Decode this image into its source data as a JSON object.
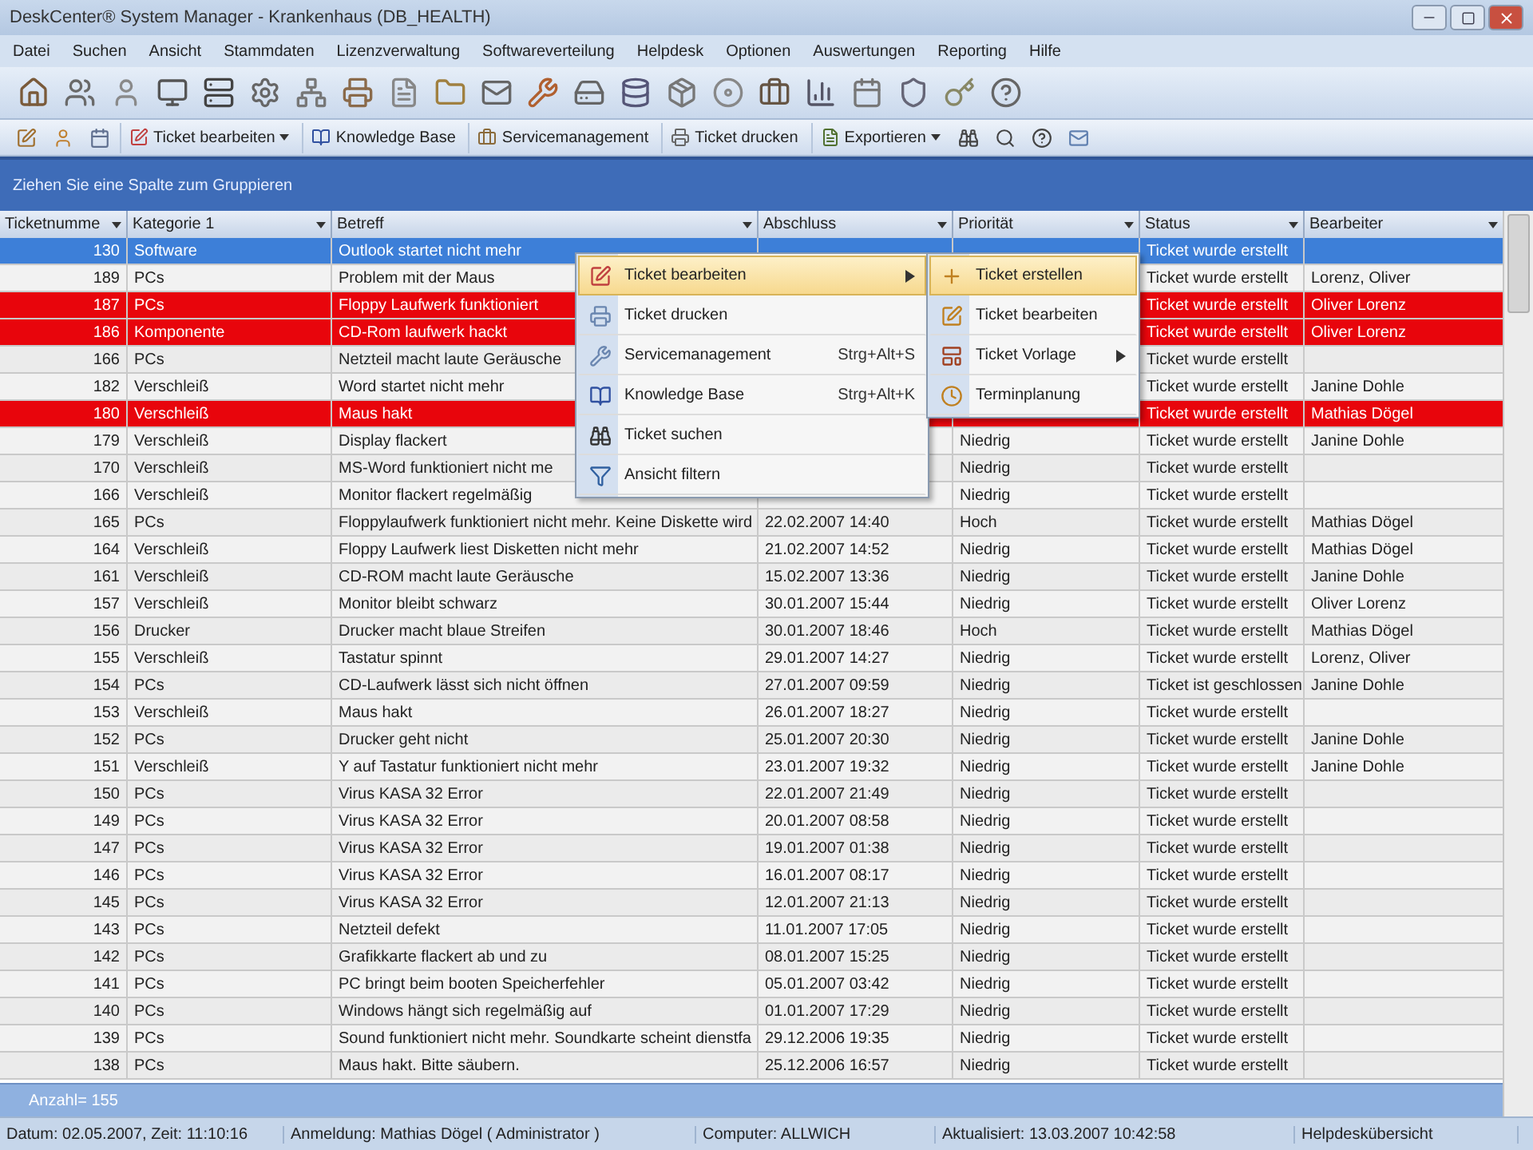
{
  "window": {
    "title": "DeskCenter® System Manager - Krankenhaus (DB_HEALTH)"
  },
  "menu": [
    "Datei",
    "Suchen",
    "Ansicht",
    "Stammdaten",
    "Lizenzverwaltung",
    "Softwareverteilung",
    "Helpdesk",
    "Optionen",
    "Auswertungen",
    "Reporting",
    "Hilfe"
  ],
  "toolbar2": [
    {
      "label": "Ticket bearbeiten",
      "dropdown": true
    },
    {
      "label": "Knowledge Base",
      "dropdown": false
    },
    {
      "label": "Servicemanagement",
      "dropdown": false
    },
    {
      "label": "Ticket drucken",
      "dropdown": false
    },
    {
      "label": "Exportieren",
      "dropdown": true
    }
  ],
  "group_banner": "Ziehen Sie eine Spalte zum Gruppieren",
  "table": {
    "columns": [
      "Ticketnumme",
      "Kategorie 1",
      "Betreff",
      "Abschluss",
      "Priorität",
      "Status",
      "Bearbeiter"
    ],
    "rows": [
      {
        "no": "130",
        "category": "Software",
        "subject": "Outlook startet nicht mehr",
        "status": "Ticket wurde erstellt",
        "flagged": false,
        "selected": true
      },
      {
        "no": "189",
        "category": "PCs",
        "subject": "Problem mit der Maus",
        "status": "Ticket wurde erstellt",
        "assignee": "Lorenz, Oliver",
        "flagged": false,
        "selected": false
      },
      {
        "no": "187",
        "category": "PCs",
        "subject": "Floppy Laufwerk funktioniert",
        "status": "Ticket wurde erstellt",
        "assignee": "Oliver Lorenz",
        "flagged": true,
        "selected": false
      },
      {
        "no": "186",
        "category": "Komponente",
        "subject": "CD-Rom laufwerk hackt",
        "status": "Ticket wurde erstellt",
        "assignee": "Oliver Lorenz",
        "flagged": true,
        "selected": false
      },
      {
        "no": "166",
        "category": "PCs",
        "subject": "Netzteil macht laute Geräusche",
        "status": "Ticket wurde erstellt",
        "flagged": false,
        "selected": false
      },
      {
        "no": "182",
        "category": "Verschleiß",
        "subject": "Word startet nicht mehr",
        "status": "Ticket wurde erstellt",
        "assignee": "Janine Dohle",
        "flagged": false,
        "selected": false
      },
      {
        "no": "180",
        "category": "Verschleiß",
        "subject": "Maus hakt",
        "status": "Ticket wurde erstellt",
        "assignee": "Mathias Dögel",
        "flagged": true,
        "selected": false
      },
      {
        "no": "179",
        "category": "Verschleiß",
        "subject": "Display flackert",
        "priority": "Niedrig",
        "status": "Ticket wurde erstellt",
        "assignee": "Janine Dohle",
        "flagged": false,
        "selected": false
      },
      {
        "no": "170",
        "category": "Verschleiß",
        "subject": "MS-Word funktioniert nicht me",
        "priority": "Niedrig",
        "status": "Ticket wurde erstellt",
        "flagged": false,
        "selected": false
      },
      {
        "no": "166",
        "category": "Verschleiß",
        "subject": "Monitor flackert regelmäßig",
        "priority": "Niedrig",
        "status": "Ticket wurde erstellt",
        "flagged": false,
        "selected": false
      },
      {
        "no": "165",
        "category": "PCs",
        "subject": "Floppylaufwerk funktioniert nicht mehr. Keine Diskette wird",
        "closed": "22.02.2007 14:40",
        "priority": "Hoch",
        "status": "Ticket wurde erstellt",
        "assignee": "Mathias Dögel",
        "flagged": false,
        "selected": false
      },
      {
        "no": "164",
        "category": "Verschleiß",
        "subject": "Floppy Laufwerk liest Disketten nicht mehr",
        "closed": "21.02.2007 14:52",
        "priority": "Niedrig",
        "status": "Ticket wurde erstellt",
        "assignee": "Mathias Dögel",
        "flagged": false,
        "selected": false
      },
      {
        "no": "161",
        "category": "Verschleiß",
        "subject": "CD-ROM macht laute Geräusche",
        "closed": "15.02.2007 13:36",
        "priority": "Niedrig",
        "status": "Ticket wurde erstellt",
        "assignee": "Janine Dohle",
        "flagged": false,
        "selected": false
      },
      {
        "no": "157",
        "category": "Verschleiß",
        "subject": "Monitor bleibt schwarz",
        "closed": "30.01.2007 15:44",
        "priority": "Niedrig",
        "status": "Ticket wurde erstellt",
        "assignee": "Oliver Lorenz",
        "flagged": false,
        "selected": false
      },
      {
        "no": "156",
        "category": "Drucker",
        "subject": "Drucker macht blaue Streifen",
        "closed": "30.01.2007 18:46",
        "priority": "Hoch",
        "status": "Ticket wurde erstellt",
        "assignee": "Mathias Dögel",
        "flagged": false,
        "selected": false
      },
      {
        "no": "155",
        "category": "Verschleiß",
        "subject": "Tastatur spinnt",
        "closed": "29.01.2007 14:27",
        "priority": "Niedrig",
        "status": "Ticket wurde erstellt",
        "assignee": "Lorenz, Oliver",
        "flagged": false,
        "selected": false
      },
      {
        "no": "154",
        "category": "PCs",
        "subject": "CD-Laufwerk lässt sich nicht öffnen",
        "closed": "27.01.2007 09:59",
        "priority": "Niedrig",
        "status": "Ticket ist geschlossen",
        "assignee": "Janine Dohle",
        "flagged": false,
        "selected": false
      },
      {
        "no": "153",
        "category": "Verschleiß",
        "subject": "Maus hakt",
        "closed": "26.01.2007 18:27",
        "priority": "Niedrig",
        "status": "Ticket wurde erstellt",
        "flagged": false,
        "selected": false
      },
      {
        "no": "152",
        "category": "PCs",
        "subject": "Drucker geht nicht",
        "closed": "25.01.2007 20:30",
        "priority": "Niedrig",
        "status": "Ticket wurde erstellt",
        "assignee": "Janine Dohle",
        "flagged": false,
        "selected": false
      },
      {
        "no": "151",
        "category": "Verschleiß",
        "subject": "Y auf Tastatur funktioniert nicht mehr",
        "closed": "23.01.2007 19:32",
        "priority": "Niedrig",
        "status": "Ticket wurde erstellt",
        "assignee": "Janine Dohle",
        "flagged": false,
        "selected": false
      },
      {
        "no": "150",
        "category": "PCs",
        "subject": "Virus KASA 32 Error",
        "closed": "22.01.2007 21:49",
        "priority": "Niedrig",
        "status": "Ticket wurde erstellt",
        "flagged": false,
        "selected": false
      },
      {
        "no": "149",
        "category": "PCs",
        "subject": "Virus KASA 32 Error",
        "closed": "20.01.2007 08:58",
        "priority": "Niedrig",
        "status": "Ticket wurde erstellt",
        "flagged": false,
        "selected": false
      },
      {
        "no": "147",
        "category": "PCs",
        "subject": "Virus KASA 32 Error",
        "closed": "19.01.2007 01:38",
        "priority": "Niedrig",
        "status": "Ticket wurde erstellt",
        "flagged": false,
        "selected": false
      },
      {
        "no": "146",
        "category": "PCs",
        "subject": "Virus KASA 32 Error",
        "closed": "16.01.2007 08:17",
        "priority": "Niedrig",
        "status": "Ticket wurde erstellt",
        "flagged": false,
        "selected": false
      },
      {
        "no": "145",
        "category": "PCs",
        "subject": "Virus KASA 32 Error",
        "closed": "12.01.2007 21:13",
        "priority": "Niedrig",
        "status": "Ticket wurde erstellt",
        "flagged": false,
        "selected": false
      },
      {
        "no": "143",
        "category": "PCs",
        "subject": "Netzteil defekt",
        "closed": "11.01.2007 17:05",
        "priority": "Niedrig",
        "status": "Ticket wurde erstellt",
        "flagged": false,
        "selected": false
      },
      {
        "no": "142",
        "category": "PCs",
        "subject": "Grafikkarte flackert ab und zu",
        "closed": "08.01.2007 15:25",
        "priority": "Niedrig",
        "status": "Ticket wurde erstellt",
        "flagged": false,
        "selected": false
      },
      {
        "no": "141",
        "category": "PCs",
        "subject": "PC bringt beim booten Speicherfehler",
        "closed": "05.01.2007 03:42",
        "priority": "Niedrig",
        "status": "Ticket wurde erstellt",
        "flagged": false,
        "selected": false
      },
      {
        "no": "140",
        "category": "PCs",
        "subject": "Windows hängt sich regelmäßig auf",
        "closed": "01.01.2007 17:29",
        "priority": "Niedrig",
        "status": "Ticket wurde erstellt",
        "flagged": false,
        "selected": false
      },
      {
        "no": "139",
        "category": "PCs",
        "subject": "Sound funktioniert nicht mehr. Soundkarte scheint dienstfa",
        "closed": "29.12.2006 19:35",
        "priority": "Niedrig",
        "status": "Ticket wurde erstellt",
        "flagged": false,
        "selected": false
      },
      {
        "no": "138",
        "category": "PCs",
        "subject": "Maus hakt. Bitte säubern.",
        "closed": "25.12.2006 16:57",
        "priority": "Niedrig",
        "status": "Ticket wurde erstellt",
        "flagged": false,
        "selected": false
      }
    ]
  },
  "context_menu": [
    {
      "label": "Ticket bearbeiten",
      "submenu": true,
      "selected": true
    },
    {
      "label": "Ticket drucken",
      "submenu": false,
      "selected": false
    },
    {
      "label": "Servicemanagement",
      "shortcut": "Strg+Alt+S",
      "submenu": false,
      "selected": false
    },
    {
      "label": "Knowledge Base",
      "shortcut": "Strg+Alt+K",
      "submenu": false,
      "selected": false
    },
    {
      "label": "Ticket suchen",
      "submenu": false,
      "selected": false
    },
    {
      "label": "Ansicht filtern",
      "submenu": false,
      "selected": false
    }
  ],
  "submenu": [
    {
      "label": "Ticket erstellen",
      "submenu": false,
      "selected": true
    },
    {
      "label": "Ticket bearbeiten",
      "submenu": false,
      "selected": false
    },
    {
      "label": "Ticket Vorlage",
      "submenu": true,
      "selected": false
    },
    {
      "label": "Terminplanung",
      "submenu": false,
      "selected": false
    }
  ],
  "footer": "Anzahl= 155",
  "status_bar": [
    "Datum: 02.05.2007, Zeit: 11:10:16",
    "Anmeldung: Mathias Dögel ( Administrator )",
    "Computer: ALLWICH",
    "Aktualisiert: 13.03.2007 10:42:58",
    "Helpdeskübersicht"
  ]
}
